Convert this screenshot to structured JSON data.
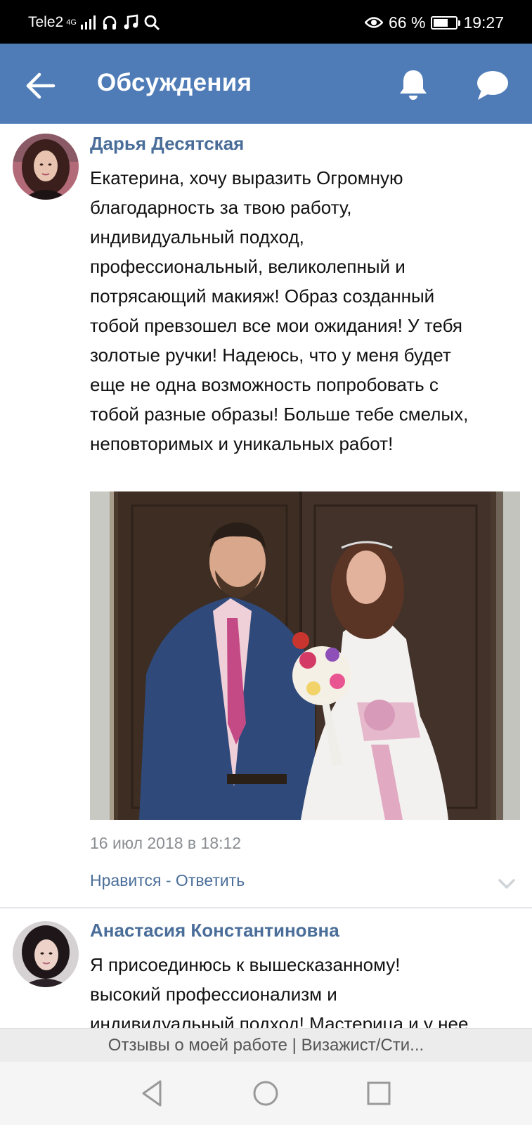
{
  "status_bar": {
    "carrier": "Tele2",
    "network": "4G",
    "eye_indicator": "eye-icon",
    "battery_percent": "66 %",
    "battery_level": 0.66,
    "time": "19:27"
  },
  "header": {
    "title": "Обсуждения",
    "icons": [
      "back-arrow-icon",
      "bell-icon",
      "chat-bubble-icon"
    ]
  },
  "colors": {
    "header_bg": "#4f7cb7",
    "author_link": "#4a6e99",
    "muted_text": "#8a8d91"
  },
  "comments": [
    {
      "author": "Дарья Десятская",
      "text_lines": [
        "Екатерина, хочу выразить Огромную",
        "благодарность за твою работу,",
        "индивидуальный подход,",
        "профессиональный, великолепный и",
        "потрясающий макияж! Образ созданный",
        "тобой превзошел все мои ожидания! У тебя",
        "золотые ручки! Надеюсь, что у меня будет",
        "еще не одна возможность попробовать с",
        "тобой разные образы! Больше тебе смелых,",
        "неповторимых и уникальных работ!"
      ],
      "date": "16 июл 2018 в 18:12",
      "actions": "Нравится - Ответить"
    },
    {
      "author": "Анастасия Константиновна",
      "text_lines": [
        "Я присоединюсь к вышесказанному!",
        "высокий профессионализм и",
        "индивидуальный подход! Мастерица и у нее"
      ]
    }
  ],
  "topic_title": "Отзывы о моей работе | Визажист/Сти..."
}
